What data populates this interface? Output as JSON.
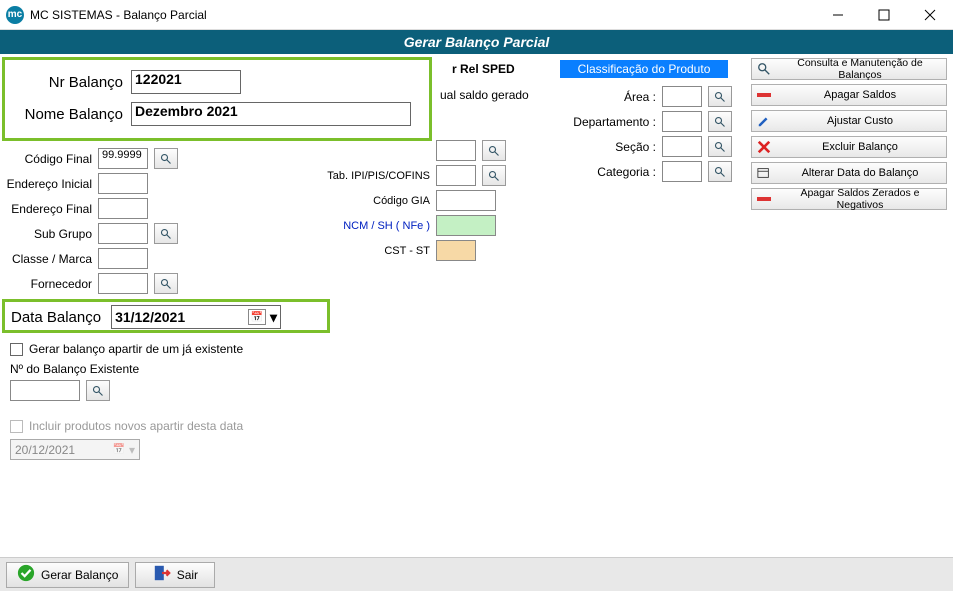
{
  "window": {
    "title": "MC SISTEMAS - Balanço Parcial",
    "app_icon_text": "mc"
  },
  "header": {
    "title": "Gerar Balanço Parcial"
  },
  "highlight": {
    "nr_label": "Nr Balanço",
    "nr_value": "122021",
    "nome_label": "Nome Balanço",
    "nome_value": "Dezembro 2021",
    "data_label": "Data Balanço",
    "data_value": "31/12/2021"
  },
  "left": {
    "cod_final_label": "Código Final",
    "cod_final_value": "99.9999",
    "end_ini_label": "Endereço Inicial",
    "end_fim_label": "Endereço Final",
    "subgrupo_label": "Sub Grupo",
    "classe_label": "Classe / Marca",
    "fornecedor_label": "Fornecedor"
  },
  "mid": {
    "sped_title": "r Rel SPED",
    "sped_sub": "ual saldo gerado",
    "tabipi_label": "Tab. IPI/PIS/COFINS",
    "gia_label": "Código GIA",
    "ncm_label": "NCM / SH ( NFe )",
    "cst_label": "CST  - ST"
  },
  "classif": {
    "header": "Classificação do Produto",
    "area": "Área :",
    "depto": "Departamento :",
    "secao": "Seção :",
    "categoria": "Categoria :"
  },
  "options": {
    "chk_existente": "Gerar balanço apartir de um já existente",
    "nr_existente_label": "Nº do Balanço Existente",
    "chk_incluir": "Incluir produtos novos apartir desta data",
    "data_incluir": "20/12/2021"
  },
  "sidebar": {
    "consulta": "Consulta e Manutenção de Balanços",
    "apagar": "Apagar Saldos",
    "ajustar": "Ajustar Custo",
    "excluir": "Excluir Balanço",
    "alterar": "Alterar Data do Balanço",
    "zerados": "Apagar Saldos Zerados e Negativos"
  },
  "bottom": {
    "gerar": "Gerar Balanço",
    "sair": "Sair"
  }
}
